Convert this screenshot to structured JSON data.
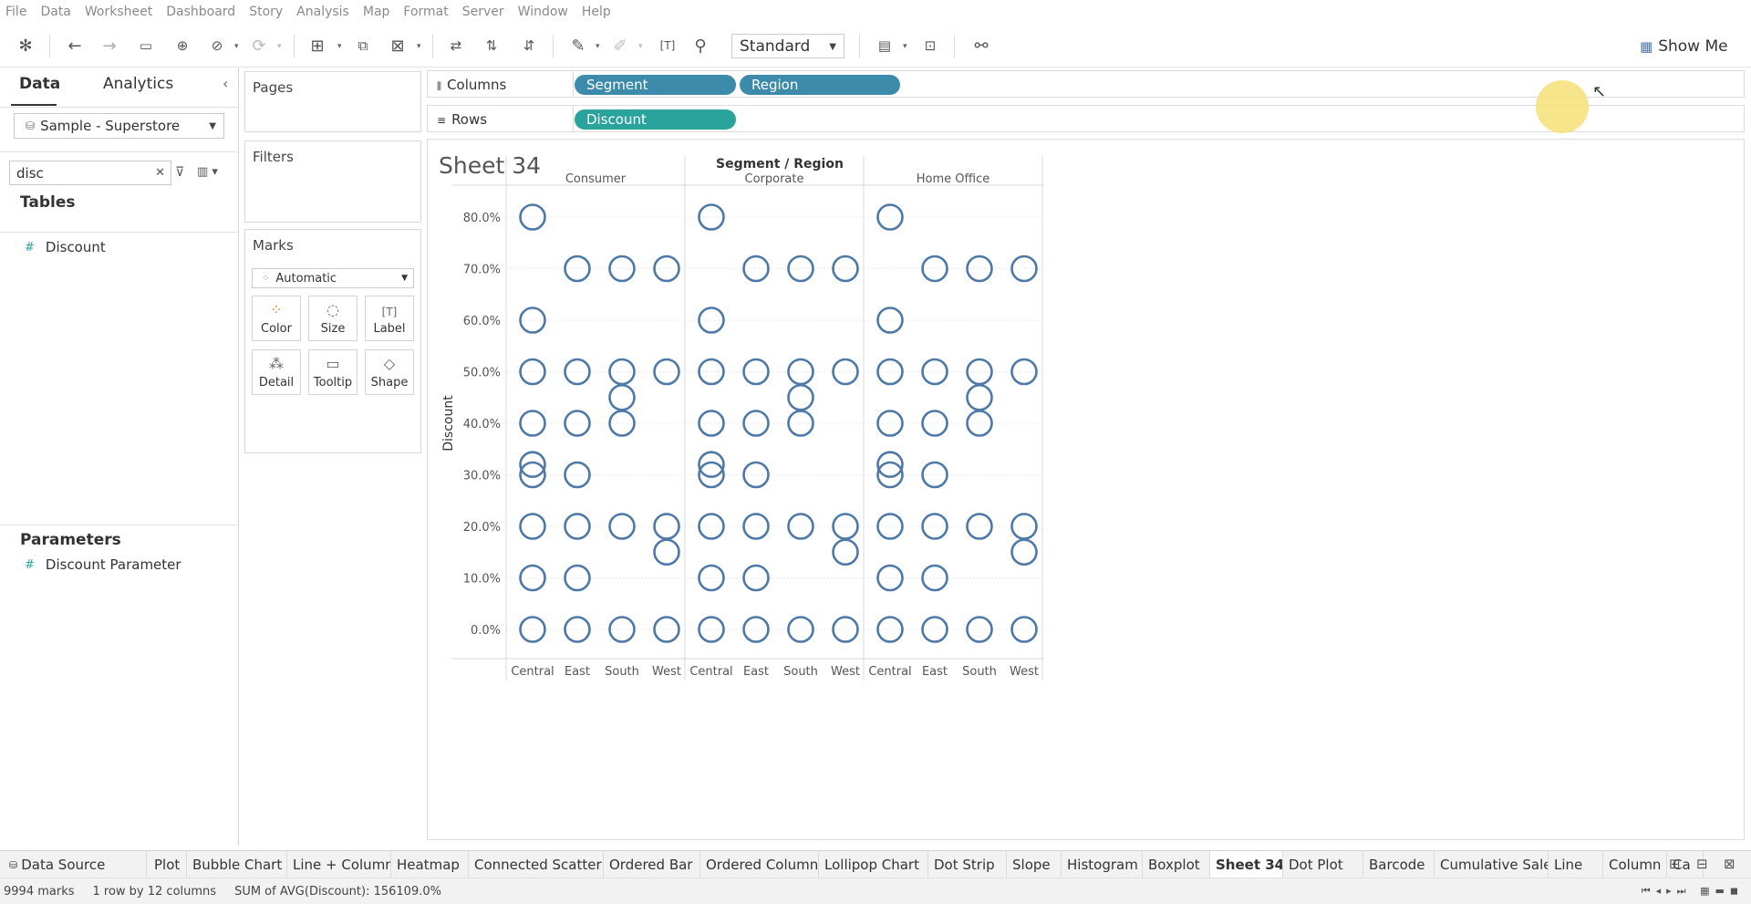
{
  "menu": [
    "File",
    "Data",
    "Worksheet",
    "Dashboard",
    "Story",
    "Analysis",
    "Map",
    "Format",
    "Server",
    "Window",
    "Help"
  ],
  "toolbar": {
    "fit_value": "Standard",
    "show_me": "Show Me"
  },
  "datapane": {
    "tab_data": "Data",
    "tab_analytics": "Analytics",
    "datasource": "Sample - Superstore",
    "search_value": "disc",
    "tables_title": "Tables",
    "tables_fields": [
      "Discount"
    ],
    "parameters_title": "Parameters",
    "parameters_fields": [
      "Discount Parameter"
    ]
  },
  "cards": {
    "pages": "Pages",
    "filters": "Filters",
    "marks": "Marks",
    "mark_type": "Automatic",
    "buttons": [
      "Color",
      "Size",
      "Label",
      "Detail",
      "Tooltip",
      "Shape"
    ]
  },
  "shelves": {
    "columns_label": "Columns",
    "rows_label": "Rows",
    "columns_pills": [
      "Segment",
      "Region"
    ],
    "rows_pills": [
      "Discount"
    ],
    "dimension_color": "#3d8bab",
    "measure_color": "#2aa39d"
  },
  "sheet_title": "Sheet 34",
  "chart_data": {
    "type": "scatter",
    "mark": "open-circle",
    "mark_color": "#4e79a7",
    "header_title": "Segment / Region",
    "ylabel": "Discount",
    "ylim": [
      0,
      0.8
    ],
    "y_ticks": [
      "0.0%",
      "10.0%",
      "20.0%",
      "30.0%",
      "40.0%",
      "50.0%",
      "60.0%",
      "70.0%",
      "80.0%"
    ],
    "panes": [
      {
        "segment": "Consumer",
        "regions": {
          "Central": [
            0,
            0.1,
            0.2,
            0.3,
            0.32,
            0.4,
            0.5,
            0.6,
            0.8
          ],
          "East": [
            0,
            0.1,
            0.2,
            0.3,
            0.4,
            0.5,
            0.7
          ],
          "South": [
            0,
            0.2,
            0.4,
            0.45,
            0.5,
            0.7
          ],
          "West": [
            0,
            0.15,
            0.2,
            0.5,
            0.7
          ]
        }
      },
      {
        "segment": "Corporate",
        "regions": {
          "Central": [
            0,
            0.1,
            0.2,
            0.3,
            0.32,
            0.4,
            0.5,
            0.6,
            0.8
          ],
          "East": [
            0,
            0.1,
            0.2,
            0.3,
            0.4,
            0.5,
            0.7
          ],
          "South": [
            0,
            0.2,
            0.4,
            0.45,
            0.5,
            0.7
          ],
          "West": [
            0,
            0.15,
            0.2,
            0.5,
            0.7
          ]
        }
      },
      {
        "segment": "Home Office",
        "regions": {
          "Central": [
            0,
            0.1,
            0.2,
            0.3,
            0.32,
            0.4,
            0.5,
            0.6,
            0.8
          ],
          "East": [
            0,
            0.1,
            0.2,
            0.3,
            0.4,
            0.5,
            0.7
          ],
          "South": [
            0,
            0.2,
            0.4,
            0.45,
            0.5,
            0.7
          ],
          "West": [
            0,
            0.15,
            0.2,
            0.5,
            0.7
          ]
        }
      }
    ],
    "region_order": [
      "Central",
      "East",
      "South",
      "West"
    ]
  },
  "sheet_tabs": [
    {
      "label": "Data Source",
      "icon": "database-icon"
    },
    {
      "label": "Plot"
    },
    {
      "label": "Bubble Chart"
    },
    {
      "label": "Line + Column"
    },
    {
      "label": "Heatmap"
    },
    {
      "label": "Connected Scatter"
    },
    {
      "label": "Ordered Bar"
    },
    {
      "label": "Ordered Column"
    },
    {
      "label": "Lollipop Chart"
    },
    {
      "label": "Dot Strip"
    },
    {
      "label": "Slope"
    },
    {
      "label": "Histogram"
    },
    {
      "label": "Boxplot"
    },
    {
      "label": "Sheet 34",
      "active": true
    },
    {
      "label": "Dot Plot"
    },
    {
      "label": "Barcode"
    },
    {
      "label": "Cumulative Sales"
    },
    {
      "label": "Line"
    },
    {
      "label": "Column"
    },
    {
      "label": "Ca"
    }
  ],
  "status": {
    "marks": "9994 marks",
    "dims": "1 row by 12 columns",
    "sum": "SUM of AVG(Discount): 156109.0%"
  }
}
